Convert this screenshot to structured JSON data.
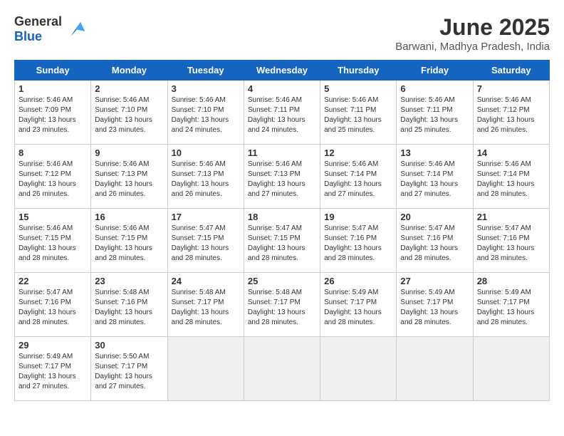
{
  "header": {
    "logo_general": "General",
    "logo_blue": "Blue",
    "month_title": "June 2025",
    "location": "Barwani, Madhya Pradesh, India"
  },
  "days_of_week": [
    "Sunday",
    "Monday",
    "Tuesday",
    "Wednesday",
    "Thursday",
    "Friday",
    "Saturday"
  ],
  "weeks": [
    [
      {
        "day": 1,
        "info": "Sunrise: 5:46 AM\nSunset: 7:09 PM\nDaylight: 13 hours\nand 23 minutes."
      },
      {
        "day": 2,
        "info": "Sunrise: 5:46 AM\nSunset: 7:10 PM\nDaylight: 13 hours\nand 23 minutes."
      },
      {
        "day": 3,
        "info": "Sunrise: 5:46 AM\nSunset: 7:10 PM\nDaylight: 13 hours\nand 24 minutes."
      },
      {
        "day": 4,
        "info": "Sunrise: 5:46 AM\nSunset: 7:11 PM\nDaylight: 13 hours\nand 24 minutes."
      },
      {
        "day": 5,
        "info": "Sunrise: 5:46 AM\nSunset: 7:11 PM\nDaylight: 13 hours\nand 25 minutes."
      },
      {
        "day": 6,
        "info": "Sunrise: 5:46 AM\nSunset: 7:11 PM\nDaylight: 13 hours\nand 25 minutes."
      },
      {
        "day": 7,
        "info": "Sunrise: 5:46 AM\nSunset: 7:12 PM\nDaylight: 13 hours\nand 26 minutes."
      }
    ],
    [
      {
        "day": 8,
        "info": "Sunrise: 5:46 AM\nSunset: 7:12 PM\nDaylight: 13 hours\nand 26 minutes."
      },
      {
        "day": 9,
        "info": "Sunrise: 5:46 AM\nSunset: 7:13 PM\nDaylight: 13 hours\nand 26 minutes."
      },
      {
        "day": 10,
        "info": "Sunrise: 5:46 AM\nSunset: 7:13 PM\nDaylight: 13 hours\nand 26 minutes."
      },
      {
        "day": 11,
        "info": "Sunrise: 5:46 AM\nSunset: 7:13 PM\nDaylight: 13 hours\nand 27 minutes."
      },
      {
        "day": 12,
        "info": "Sunrise: 5:46 AM\nSunset: 7:14 PM\nDaylight: 13 hours\nand 27 minutes."
      },
      {
        "day": 13,
        "info": "Sunrise: 5:46 AM\nSunset: 7:14 PM\nDaylight: 13 hours\nand 27 minutes."
      },
      {
        "day": 14,
        "info": "Sunrise: 5:46 AM\nSunset: 7:14 PM\nDaylight: 13 hours\nand 28 minutes."
      }
    ],
    [
      {
        "day": 15,
        "info": "Sunrise: 5:46 AM\nSunset: 7:15 PM\nDaylight: 13 hours\nand 28 minutes."
      },
      {
        "day": 16,
        "info": "Sunrise: 5:46 AM\nSunset: 7:15 PM\nDaylight: 13 hours\nand 28 minutes."
      },
      {
        "day": 17,
        "info": "Sunrise: 5:47 AM\nSunset: 7:15 PM\nDaylight: 13 hours\nand 28 minutes."
      },
      {
        "day": 18,
        "info": "Sunrise: 5:47 AM\nSunset: 7:15 PM\nDaylight: 13 hours\nand 28 minutes."
      },
      {
        "day": 19,
        "info": "Sunrise: 5:47 AM\nSunset: 7:16 PM\nDaylight: 13 hours\nand 28 minutes."
      },
      {
        "day": 20,
        "info": "Sunrise: 5:47 AM\nSunset: 7:16 PM\nDaylight: 13 hours\nand 28 minutes."
      },
      {
        "day": 21,
        "info": "Sunrise: 5:47 AM\nSunset: 7:16 PM\nDaylight: 13 hours\nand 28 minutes."
      }
    ],
    [
      {
        "day": 22,
        "info": "Sunrise: 5:47 AM\nSunset: 7:16 PM\nDaylight: 13 hours\nand 28 minutes."
      },
      {
        "day": 23,
        "info": "Sunrise: 5:48 AM\nSunset: 7:16 PM\nDaylight: 13 hours\nand 28 minutes."
      },
      {
        "day": 24,
        "info": "Sunrise: 5:48 AM\nSunset: 7:17 PM\nDaylight: 13 hours\nand 28 minutes."
      },
      {
        "day": 25,
        "info": "Sunrise: 5:48 AM\nSunset: 7:17 PM\nDaylight: 13 hours\nand 28 minutes."
      },
      {
        "day": 26,
        "info": "Sunrise: 5:49 AM\nSunset: 7:17 PM\nDaylight: 13 hours\nand 28 minutes."
      },
      {
        "day": 27,
        "info": "Sunrise: 5:49 AM\nSunset: 7:17 PM\nDaylight: 13 hours\nand 28 minutes."
      },
      {
        "day": 28,
        "info": "Sunrise: 5:49 AM\nSunset: 7:17 PM\nDaylight: 13 hours\nand 28 minutes."
      }
    ],
    [
      {
        "day": 29,
        "info": "Sunrise: 5:49 AM\nSunset: 7:17 PM\nDaylight: 13 hours\nand 27 minutes."
      },
      {
        "day": 30,
        "info": "Sunrise: 5:50 AM\nSunset: 7:17 PM\nDaylight: 13 hours\nand 27 minutes."
      },
      {
        "day": null,
        "info": ""
      },
      {
        "day": null,
        "info": ""
      },
      {
        "day": null,
        "info": ""
      },
      {
        "day": null,
        "info": ""
      },
      {
        "day": null,
        "info": ""
      }
    ]
  ]
}
